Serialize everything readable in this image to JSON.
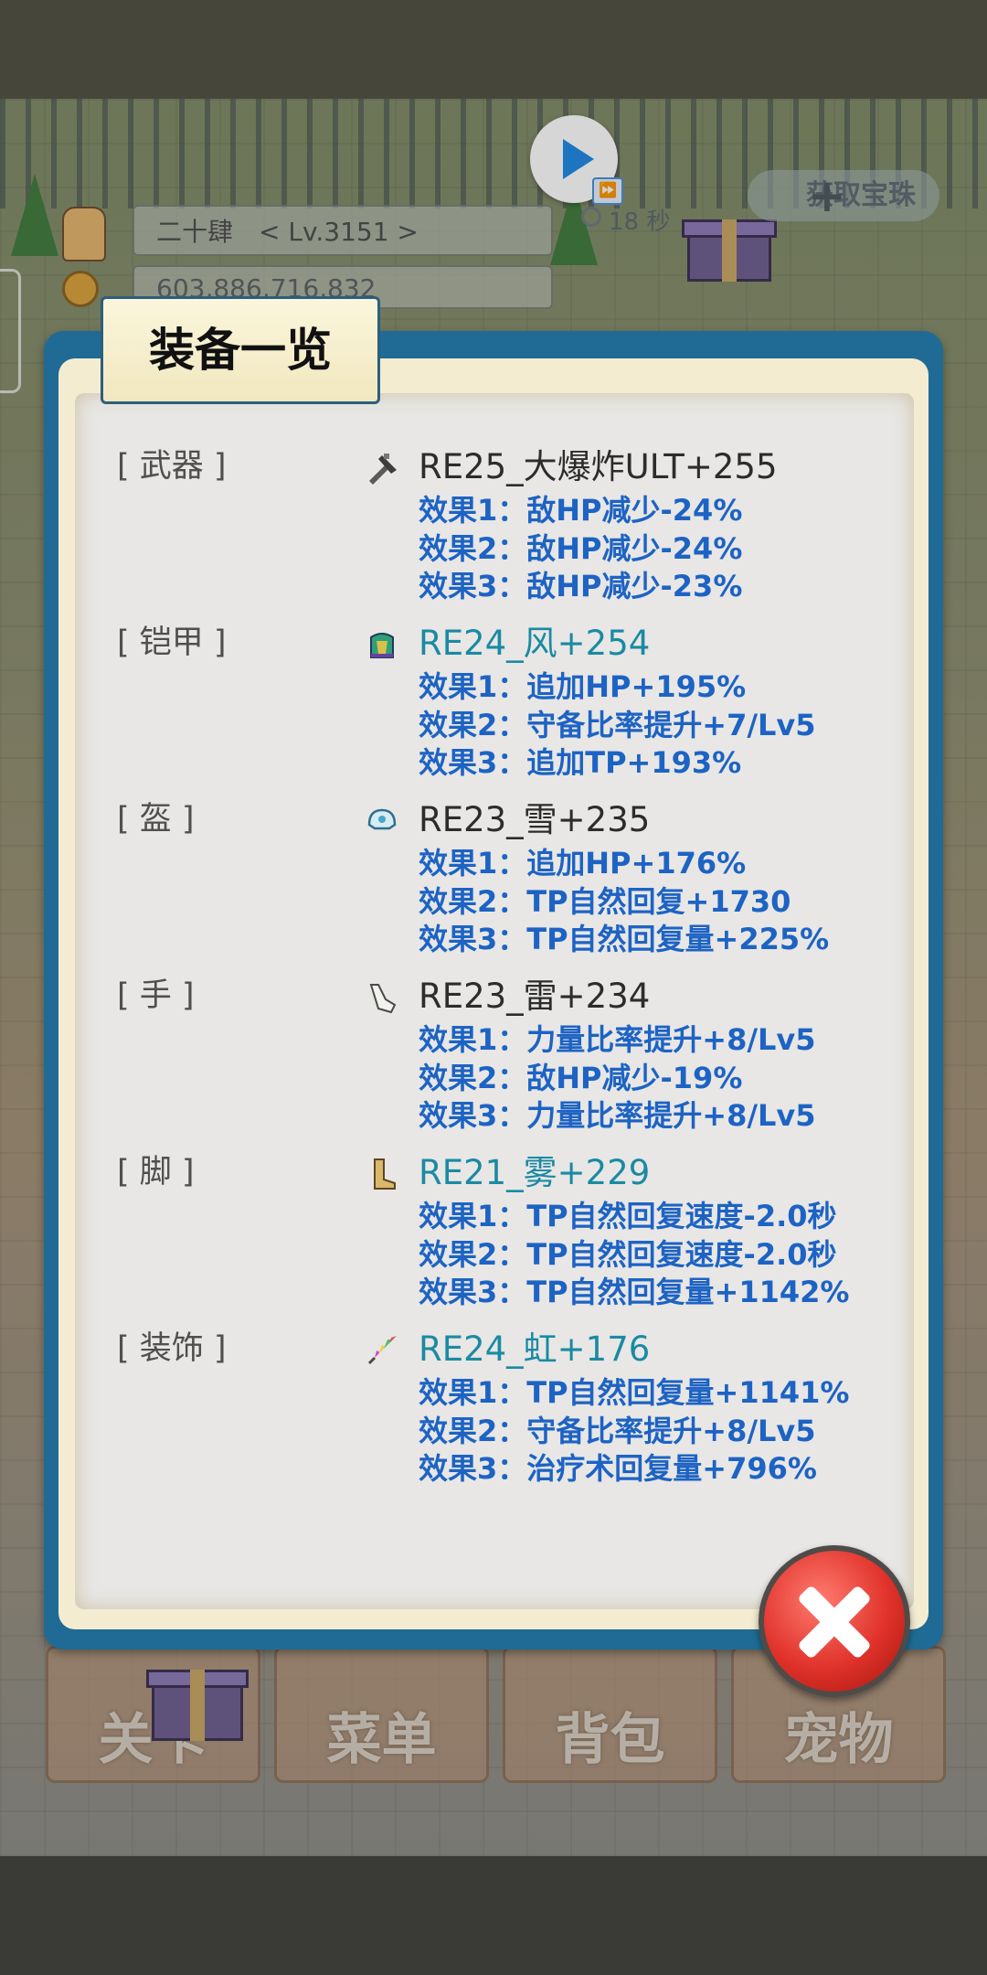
{
  "hud": {
    "player_name_level": "二十肆　< Lv.3151 >",
    "gold": "603,886,716,832",
    "ad_timer": "18 秒",
    "get_button_label": "获取宝珠"
  },
  "bottom_menu": {
    "items": [
      {
        "label": "关卡"
      },
      {
        "label": "菜单"
      },
      {
        "label": "背包"
      },
      {
        "label": "宠物"
      }
    ]
  },
  "dialog": {
    "title": "装备一览",
    "slots": [
      {
        "label": "[ 武器 ]",
        "icon": "sword-icon",
        "name": "RE25_大爆炸ULT+255",
        "name_color": "#2c2c2c",
        "effects": [
          "效果1：敌HP减少-24%",
          "效果2：敌HP减少-24%",
          "效果3：敌HP减少-23%"
        ]
      },
      {
        "label": "[ 铠甲 ]",
        "icon": "armor-icon",
        "name": "RE24_风+254",
        "name_color": "#1a8aa3",
        "effects": [
          "效果1：追加HP+195%",
          "效果2：守备比率提升+7/Lv5",
          "效果3：追加TP+193%"
        ]
      },
      {
        "label": "[ 盔 ]",
        "icon": "helmet-icon",
        "name": "RE23_雪+235",
        "name_color": "#2c2c2c",
        "effects": [
          "效果1：追加HP+176%",
          "效果2：TP自然回复+1730",
          "效果3：TP自然回复量+225%"
        ]
      },
      {
        "label": "[ 手 ]",
        "icon": "gauntlet-icon",
        "name": "RE23_雷+234",
        "name_color": "#2c2c2c",
        "effects": [
          "效果1：力量比率提升+8/Lv5",
          "效果2：敌HP减少-19%",
          "效果3：力量比率提升+8/Lv5"
        ]
      },
      {
        "label": "[ 脚 ]",
        "icon": "boot-icon",
        "name": "RE21_雾+229",
        "name_color": "#1a8aa3",
        "effects": [
          "效果1：TP自然回复速度-2.0秒",
          "效果2：TP自然回复速度-2.0秒",
          "效果3：TP自然回复量+1142%"
        ]
      },
      {
        "label": "[ 装饰 ]",
        "icon": "feather-icon",
        "name": "RE24_虹+176",
        "name_color": "#1a8aa3",
        "effects": [
          "效果1：TP自然回复量+1141%",
          "效果2：守备比率提升+8/Lv5",
          "效果3：治疗术回复量+796%"
        ]
      }
    ]
  }
}
